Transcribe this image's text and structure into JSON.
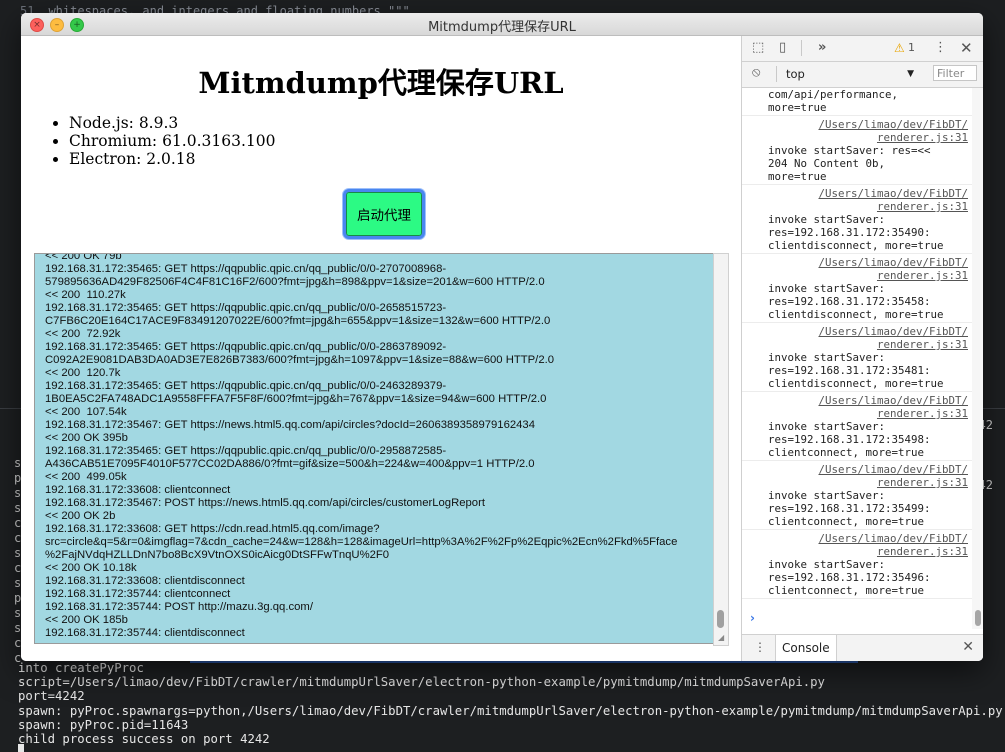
{
  "terminal": {
    "top_line_number": "51",
    "top_line_text": "whitespaces, and integers and floating numbers.\"\"\"",
    "left_chars": [
      "s",
      "p",
      "s",
      "s",
      "c",
      "c",
      "s",
      "c",
      "s",
      "p",
      "s",
      "s",
      "c",
      "c"
    ],
    "right_text": [
      "42",
      "",
      "",
      "",
      "42",
      "",
      "",
      "",
      "",
      "",
      "",
      "",
      ""
    ],
    "lines": [
      "into createPyProc",
      "script=/Users/limao/dev/FibDT/crawler/mitmdumpUrlSaver/electron-python-example/pymitmdump/mitmdumpSaverApi.py",
      "port=4242",
      "spawn: pyProc.spawnargs=python,/Users/limao/dev/FibDT/crawler/mitmdumpUrlSaver/electron-python-example/pymitmdump/mitmdumpSaverApi.py,4242",
      "spawn: pyProc.pid=11643",
      "child process success on port 4242"
    ]
  },
  "window": {
    "title": "Mitmdump代理保存URL"
  },
  "page": {
    "heading": "Mitmdump代理保存URL",
    "versions": [
      "Node.js: 8.9.3",
      "Chromium: 61.0.3163.100",
      "Electron: 2.0.18"
    ],
    "start_button": "启动代理",
    "log_lines": [
      "<< 200 OK 79b",
      "192.168.31.172:35465: GET https://qqpublic.qpic.cn/qq_public/0/0-2707008968-",
      "579895636AD429F82506F4C4F81C16F2/600?fmt=jpg&h=898&ppv=1&size=201&w=600 HTTP/2.0",
      "<< 200  110.27k",
      "192.168.31.172:35465: GET https://qqpublic.qpic.cn/qq_public/0/0-2658515723-",
      "C7FB6C20E164C17ACE9F83491207022E/600?fmt=jpg&h=655&ppv=1&size=132&w=600 HTTP/2.0",
      "<< 200  72.92k",
      "192.168.31.172:35465: GET https://qqpublic.qpic.cn/qq_public/0/0-2863789092-",
      "C092A2E9081DAB3DA0AD3E7E826B7383/600?fmt=jpg&h=1097&ppv=1&size=88&w=600 HTTP/2.0",
      "<< 200  120.7k",
      "192.168.31.172:35465: GET https://qqpublic.qpic.cn/qq_public/0/0-2463289379-",
      "1B0EA5C2FA748ADC1A9558FFFA7F5F8F/600?fmt=jpg&h=767&ppv=1&size=94&w=600 HTTP/2.0",
      "<< 200  107.54k",
      "192.168.31.172:35467: GET https://news.html5.qq.com/api/circles?docId=2606389358979162434",
      "<< 200 OK 395b",
      "192.168.31.172:35465: GET https://qqpublic.qpic.cn/qq_public/0/0-2958872585-",
      "A436CAB51E7095F4010F577CC02DA886/0?fmt=gif&size=500&h=224&w=400&ppv=1 HTTP/2.0",
      "<< 200  499.05k",
      "192.168.31.172:33608: clientconnect",
      "192.168.31.172:35467: POST https://news.html5.qq.com/api/circles/customerLogReport",
      "<< 200 OK 2b",
      "192.168.31.172:33608: GET https://cdn.read.html5.qq.com/image?",
      "src=circle&q=5&r=0&imgflag=7&cdn_cache=24&w=128&h=128&imageUrl=http%3A%2F%2Fp%2Eqpic%2Ecn%2Fkd%5Fface",
      "%2FajNVdqHZLLDnN7bo8BcX9VtnOXS0icAicg0DtSFFwTnqU%2F0",
      "<< 200 OK 10.18k",
      "192.168.31.172:33608: clientdisconnect",
      "192.168.31.172:35744: clientconnect",
      "192.168.31.172:35744: POST http://mazu.3g.qq.com/",
      "<< 200 OK 185b",
      "192.168.31.172:35744: clientdisconnect"
    ]
  },
  "devtools": {
    "tab_more": "»",
    "warning_count": "1",
    "context": "top",
    "filter_placeholder": "Filter",
    "drawer_tab": "Console",
    "messages": [
      {
        "src": "",
        "body": "com/api/performance,\nmore=true"
      },
      {
        "src": "/Users/limao/dev/FibDT/\nrenderer.js:31",
        "body": "invoke startSaver: res=<<\n204 No Content 0b,\nmore=true"
      },
      {
        "src": "/Users/limao/dev/FibDT/\nrenderer.js:31",
        "body": "invoke startSaver:\nres=192.168.31.172:35490:\nclientdisconnect, more=true"
      },
      {
        "src": "/Users/limao/dev/FibDT/\nrenderer.js:31",
        "body": "invoke startSaver:\nres=192.168.31.172:35458:\nclientdisconnect, more=true"
      },
      {
        "src": "/Users/limao/dev/FibDT/\nrenderer.js:31",
        "body": "invoke startSaver:\nres=192.168.31.172:35481:\nclientdisconnect, more=true"
      },
      {
        "src": "/Users/limao/dev/FibDT/\nrenderer.js:31",
        "body": "invoke startSaver:\nres=192.168.31.172:35498:\nclientconnect, more=true"
      },
      {
        "src": "/Users/limao/dev/FibDT/\nrenderer.js:31",
        "body": "invoke startSaver:\nres=192.168.31.172:35499:\nclientconnect, more=true"
      },
      {
        "src": "/Users/limao/dev/FibDT/\nrenderer.js:31",
        "body": "invoke startSaver:\nres=192.168.31.172:35496:\nclientconnect, more=true"
      }
    ]
  }
}
